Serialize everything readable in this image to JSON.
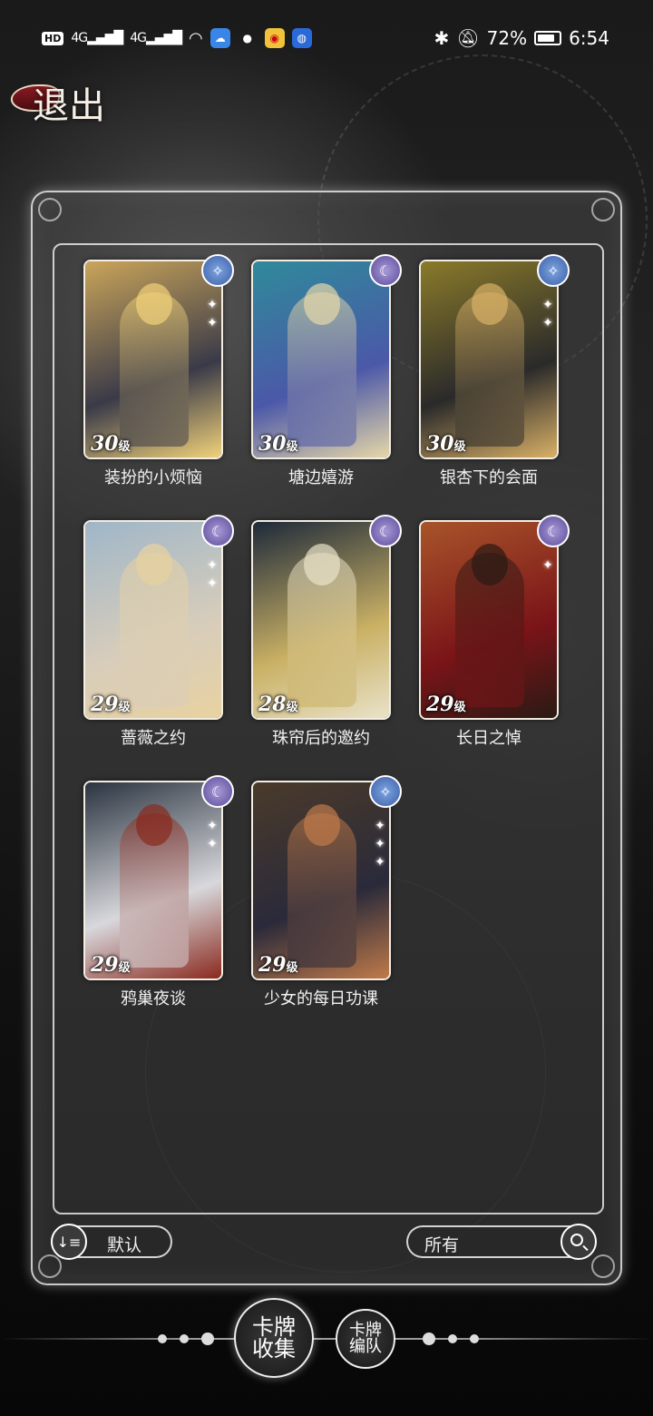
{
  "status_bar": {
    "network_chip": "HD",
    "signal_1": "4G",
    "signal_2": "4G",
    "battery": "72%",
    "time": "6:54",
    "icons": [
      "wifi-icon",
      "cloud-icon",
      "wechat-icon",
      "weibo-icon",
      "browser-icon",
      "bluetooth-icon",
      "mute-icon",
      "battery-icon"
    ]
  },
  "header": {
    "exit_label": "退出"
  },
  "cards": [
    {
      "title": "装扮的小烦恼",
      "level": "30",
      "level_unit": "级",
      "emblem": "star-emblem-blue",
      "sparkles": 2,
      "palette": [
        "#caa55a",
        "#3a3a48",
        "#f1d27a"
      ]
    },
    {
      "title": "塘边嬉游",
      "level": "30",
      "level_unit": "级",
      "emblem": "moon-emblem-purple",
      "sparkles": 0,
      "palette": [
        "#2f8a9a",
        "#4b58a8",
        "#e6d7a8"
      ]
    },
    {
      "title": "银杏下的会面",
      "level": "30",
      "level_unit": "级",
      "emblem": "star-emblem-blue",
      "sparkles": 2,
      "palette": [
        "#8a7a2a",
        "#2a2a2a",
        "#d9b066"
      ]
    },
    {
      "title": "蔷薇之约",
      "level": "29",
      "level_unit": "级",
      "emblem": "moon-emblem-purple",
      "sparkles": 2,
      "palette": [
        "#9fb6c8",
        "#d8cdbb",
        "#e8d2a0"
      ]
    },
    {
      "title": "珠帘后的邀约",
      "level": "28",
      "level_unit": "级",
      "emblem": "moon-emblem-purple",
      "sparkles": 0,
      "palette": [
        "#1e2a3a",
        "#c9b064",
        "#e9e2c8"
      ]
    },
    {
      "title": "长日之悼",
      "level": "29",
      "level_unit": "级",
      "emblem": "moon-emblem-purple",
      "sparkles": 1,
      "palette": [
        "#a8542a",
        "#7a1418",
        "#2a1a14"
      ]
    },
    {
      "title": "鸦巢夜谈",
      "level": "29",
      "level_unit": "级",
      "emblem": "moon-emblem-purple",
      "sparkles": 2,
      "palette": [
        "#2a3440",
        "#d8d8dc",
        "#8a2a1e"
      ]
    },
    {
      "title": "少女的每日功课",
      "level": "29",
      "level_unit": "级",
      "emblem": "star-emblem-blue",
      "sparkles": 3,
      "palette": [
        "#4a3a2a",
        "#2a2a3a",
        "#c07a4a"
      ]
    }
  ],
  "controls": {
    "sort_label": "默认",
    "filter_label": "所有"
  },
  "bottom_nav": {
    "collection_label": "卡牌收集",
    "team_label": "卡牌编队"
  }
}
